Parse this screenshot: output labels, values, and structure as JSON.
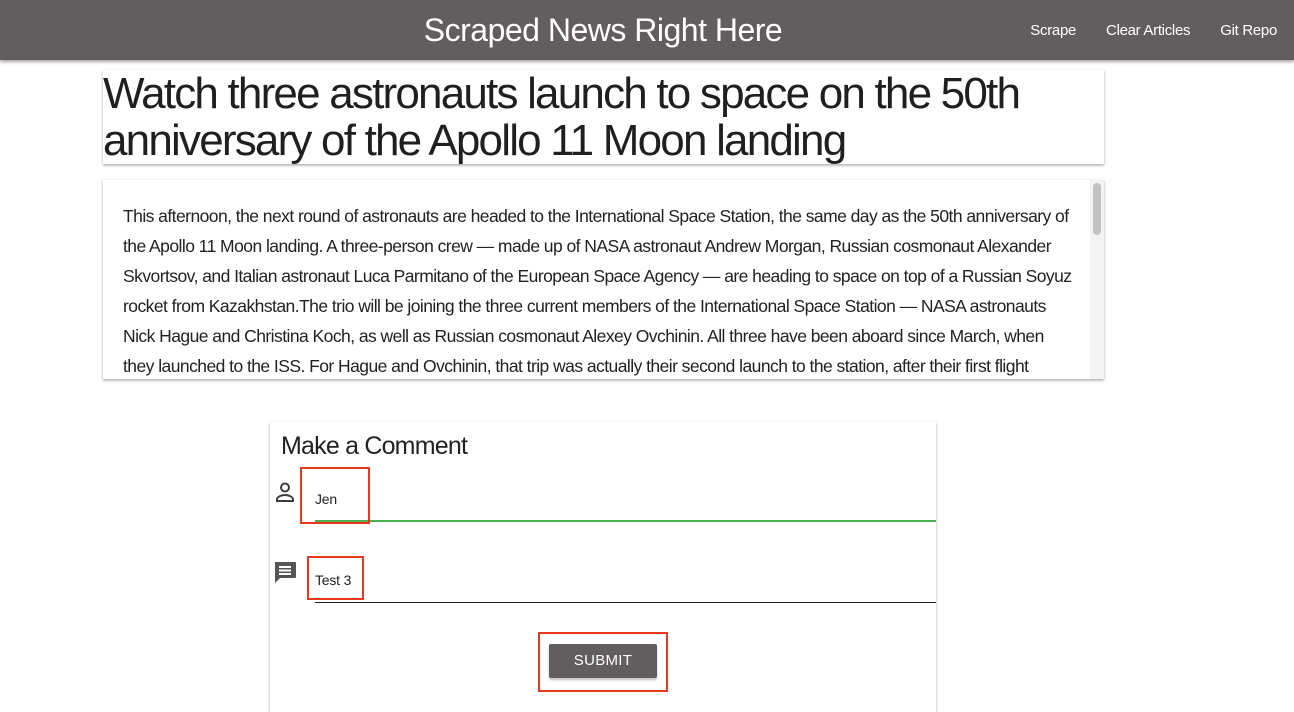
{
  "navbar": {
    "brand": "Scraped News Right Here",
    "links": [
      "Scrape",
      "Clear Articles",
      "Git Repo"
    ]
  },
  "article": {
    "title": "Watch three astronauts launch to space on the 50th anniversary of the Apollo 11 Moon landing",
    "body": "This afternoon, the next round of astronauts are headed to the International Space Station, the same day as the 50th anniversary of the Apollo 11 Moon landing. A three-person crew — made up of NASA astronaut Andrew Morgan, Russian cosmonaut Alexander Skvortsov, and Italian astronaut Luca Parmitano of the European Space Agency — are heading to space on top of a Russian Soyuz rocket from Kazakhstan.The trio will be joining the three current members of the International Space Station — NASA astronauts Nick Hague and Christina Koch, as well as Russian cosmonaut Alexey Ovchinin. All three have been aboard since March, when they launched to the ISS. For Hague and Ovchinin, that trip was actually their second launch to the station, after their first flight ended"
  },
  "comment_form": {
    "title": "Make a Comment",
    "name_value": "Jen",
    "comment_value": "Test 3",
    "submit_label": "SUBMIT"
  },
  "colors": {
    "navbar": "#625d5e",
    "active_field": "#4caf50",
    "highlight": "#e8361f"
  },
  "icons": {
    "name_field": "person-icon",
    "comment_field": "comment-icon"
  }
}
